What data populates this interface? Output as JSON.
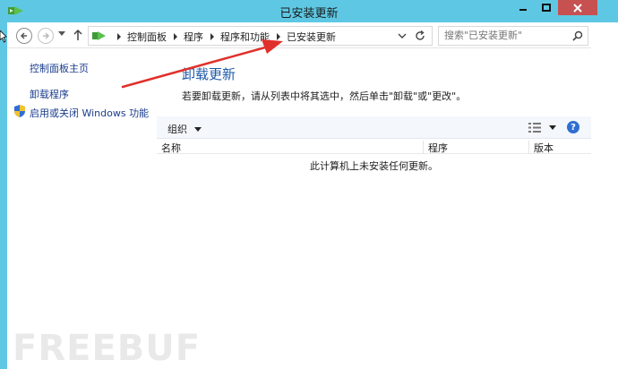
{
  "window": {
    "title": "已安装更新",
    "frame_color": "#5ec8e4",
    "close_color": "#c75050"
  },
  "address_bar": {
    "breadcrumbs": [
      "控制面板",
      "程序",
      "程序和功能",
      "已安装更新"
    ],
    "icon": "control-panel-icon"
  },
  "search": {
    "placeholder": "搜索\"已安装更新\""
  },
  "left_pane": {
    "home_link": "控制面板主页",
    "uninstall_link": "卸载程序",
    "features_link": "启用或关闭 Windows 功能"
  },
  "main": {
    "heading": "卸载更新",
    "description": "若要卸载更新，请从列表中将其选中，然后单击\"卸载\"或\"更改\"。",
    "toolbar": {
      "organize": "组织",
      "help": "?"
    },
    "columns": [
      "名称",
      "程序",
      "版本"
    ],
    "empty_message": "此计算机上未安装任何更新。"
  },
  "watermark": "FREEBUF",
  "annotation": {
    "arrow_color": "#e0302b"
  }
}
